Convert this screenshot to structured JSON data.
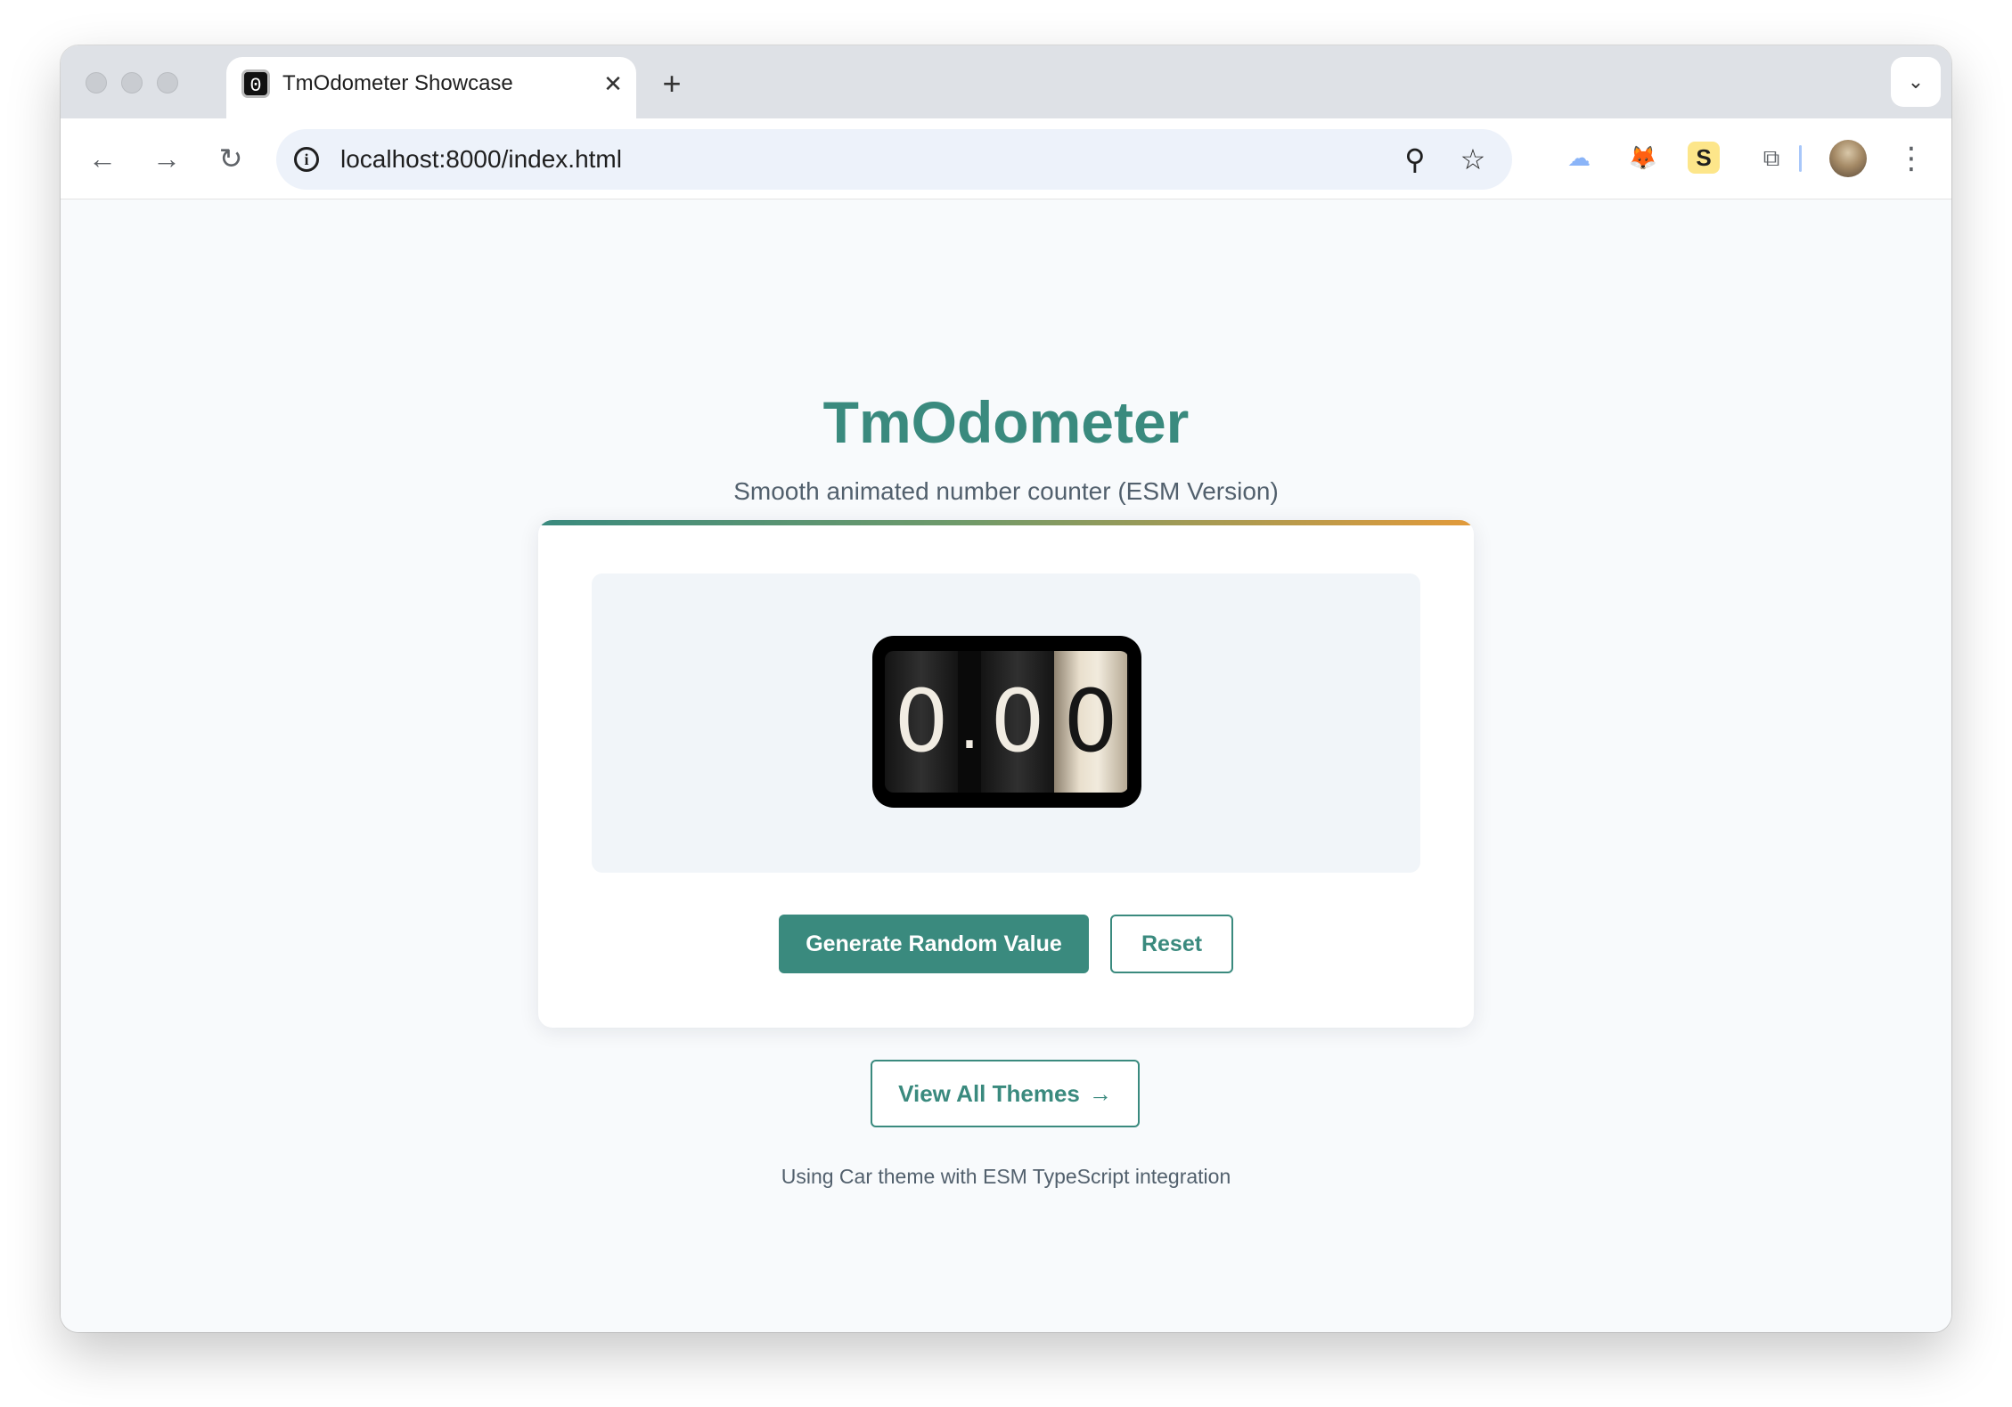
{
  "browser": {
    "tab": {
      "favicon_glyph": "0",
      "title": "TmOdometer Showcase",
      "close_glyph": "✕"
    },
    "new_tab_glyph": "+",
    "tab_dropdown_glyph": "⌄",
    "nav": {
      "back_glyph": "←",
      "forward_glyph": "→",
      "reload_glyph": "↻"
    },
    "omnibox": {
      "info_glyph": "i",
      "url": "localhost:8000/index.html",
      "zoom_glyph": "⚲",
      "bookmark_glyph": "☆"
    },
    "extensions": [
      {
        "name": "cloud-extension-icon",
        "glyph": "☁",
        "color": "#8ab4f8"
      },
      {
        "name": "fox-extension-icon",
        "glyph": "🦊",
        "color": "#e2761b"
      },
      {
        "name": "s-extension-icon",
        "glyph": "S",
        "color": "#1f1f1f",
        "bg": "#fde68a"
      },
      {
        "name": "puzzle-extensions-icon",
        "glyph": "⧉",
        "color": "#5f6368"
      }
    ],
    "menu_glyph": "⋮"
  },
  "page": {
    "title": "TmOdometer",
    "subtitle": "Smooth animated number counter (ESM Version)",
    "odometer": {
      "digits": [
        "0",
        ".",
        "0",
        "0"
      ]
    },
    "buttons": {
      "generate_label": "Generate Random Value",
      "reset_label": "Reset"
    },
    "themes_link": {
      "label": "View All Themes",
      "arrow": "→"
    },
    "footer": "Using Car theme with ESM TypeScript integration"
  },
  "colors": {
    "accent": "#3a8a7e",
    "accent_gradient_end": "#e29a3a",
    "muted_text": "#52606d"
  }
}
